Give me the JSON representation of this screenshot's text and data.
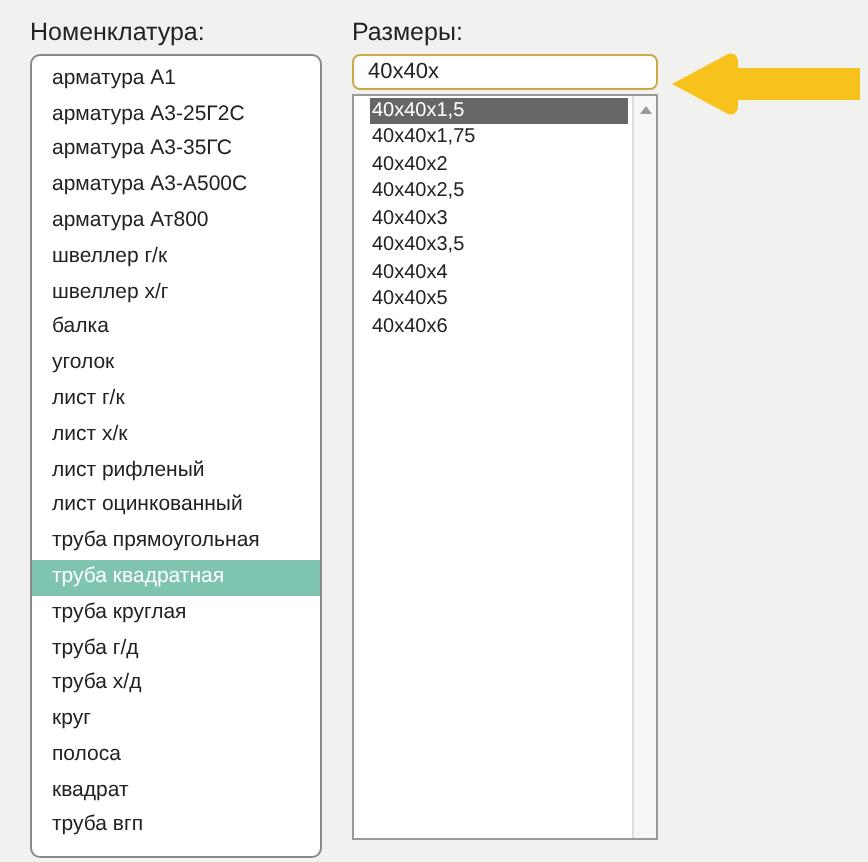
{
  "nomenclature": {
    "label": "Номенклатура:",
    "items": [
      {
        "text": "арматура А1",
        "selected": false
      },
      {
        "text": "арматура А3-25Г2С",
        "selected": false
      },
      {
        "text": "арматура А3-35ГС",
        "selected": false
      },
      {
        "text": "арматура А3-А500С",
        "selected": false
      },
      {
        "text": "арматура Ат800",
        "selected": false
      },
      {
        "text": "швеллер г/к",
        "selected": false
      },
      {
        "text": "швеллер х/г",
        "selected": false
      },
      {
        "text": "балка",
        "selected": false
      },
      {
        "text": "уголок",
        "selected": false
      },
      {
        "text": "лист г/к",
        "selected": false
      },
      {
        "text": "лист х/к",
        "selected": false
      },
      {
        "text": "лист рифленый",
        "selected": false
      },
      {
        "text": "лист оцинкованный",
        "selected": false
      },
      {
        "text": "труба прямоугольная",
        "selected": false
      },
      {
        "text": "труба квадратная",
        "selected": true
      },
      {
        "text": "труба круглая",
        "selected": false
      },
      {
        "text": "труба г/д",
        "selected": false
      },
      {
        "text": "труба х/д",
        "selected": false
      },
      {
        "text": "круг",
        "selected": false
      },
      {
        "text": "полоса",
        "selected": false
      },
      {
        "text": "квадрат",
        "selected": false
      },
      {
        "text": "труба вгп",
        "selected": false
      }
    ]
  },
  "sizes": {
    "label": "Размеры:",
    "value": "40x40x",
    "options": [
      {
        "text": "40x40x1,5",
        "selected": true
      },
      {
        "text": "40x40x1,75",
        "selected": false
      },
      {
        "text": "40x40x2",
        "selected": false
      },
      {
        "text": "40x40x2,5",
        "selected": false
      },
      {
        "text": "40x40x3",
        "selected": false
      },
      {
        "text": "40x40x3,5",
        "selected": false
      },
      {
        "text": "40x40x4",
        "selected": false
      },
      {
        "text": "40x40x5",
        "selected": false
      },
      {
        "text": "40x40x6",
        "selected": false
      }
    ]
  }
}
